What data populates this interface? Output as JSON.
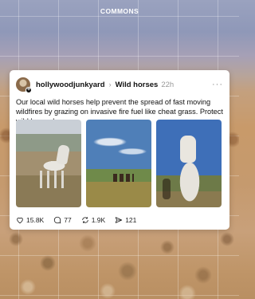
{
  "header": {
    "title": "COMMONS"
  },
  "post": {
    "username": "hollywoodjunkyard",
    "community": "Wild horses",
    "timestamp": "22h",
    "text": "Our local wild horses help prevent the spread of fast moving wildfires by grazing on invasive fire fuel like cheat grass. Protect wild horses!",
    "photos": [
      {
        "icon": "white-horse-in-field-photo"
      },
      {
        "icon": "horse-herd-under-blue-sky-photo"
      },
      {
        "icon": "white-horse-closeup-photo"
      }
    ],
    "actions": {
      "likes": "15.8K",
      "replies": "77",
      "reposts": "1.9K",
      "shares": "121"
    }
  },
  "colors": {
    "card_bg": "#ffffff",
    "text": "#111111",
    "muted": "#999999"
  }
}
